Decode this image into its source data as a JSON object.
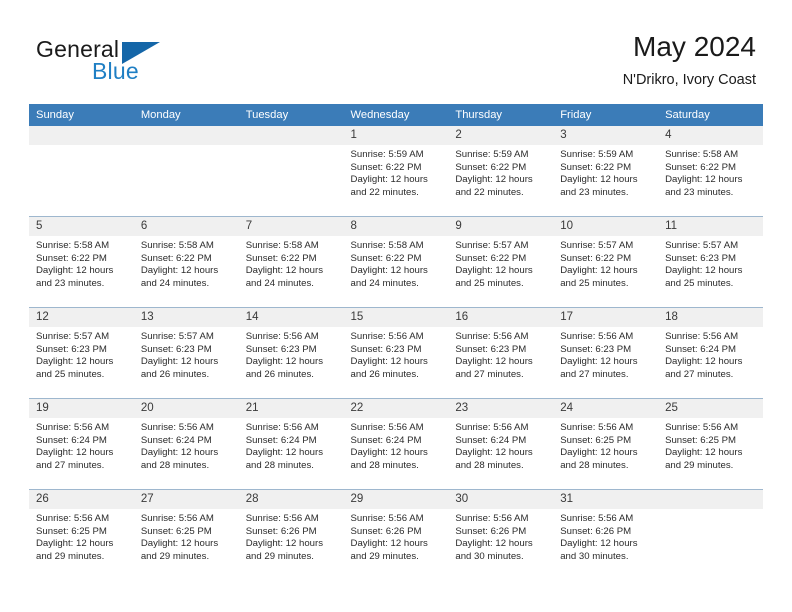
{
  "brand": {
    "word1": "General",
    "word2": "Blue",
    "flag_color": "#1466a8",
    "blue_color": "#1f7fc4"
  },
  "header": {
    "title": "May 2024",
    "subtitle": "N'Drikro, Ivory Coast"
  },
  "colors": {
    "header_row": "#3b7cb8",
    "daynum_band": "#f0f0f0",
    "grid_line": "#9fb8cf",
    "text": "#2b2b2b"
  },
  "weekday_headers": [
    "Sunday",
    "Monday",
    "Tuesday",
    "Wednesday",
    "Thursday",
    "Friday",
    "Saturday"
  ],
  "labels": {
    "sunrise_prefix": "Sunrise: ",
    "sunset_prefix": "Sunset: ",
    "daylight_prefix": "Daylight: "
  },
  "weeks": [
    [
      {
        "day": "",
        "blank": true,
        "sunrise": "",
        "sunset": "",
        "daylight_line1": "",
        "daylight_line2": ""
      },
      {
        "day": "",
        "blank": true,
        "sunrise": "",
        "sunset": "",
        "daylight_line1": "",
        "daylight_line2": ""
      },
      {
        "day": "",
        "blank": true,
        "sunrise": "",
        "sunset": "",
        "daylight_line1": "",
        "daylight_line2": ""
      },
      {
        "day": "1",
        "blank": false,
        "sunrise": "Sunrise: 5:59 AM",
        "sunset": "Sunset: 6:22 PM",
        "daylight_line1": "Daylight: 12 hours",
        "daylight_line2": "and 22 minutes."
      },
      {
        "day": "2",
        "blank": false,
        "sunrise": "Sunrise: 5:59 AM",
        "sunset": "Sunset: 6:22 PM",
        "daylight_line1": "Daylight: 12 hours",
        "daylight_line2": "and 22 minutes."
      },
      {
        "day": "3",
        "blank": false,
        "sunrise": "Sunrise: 5:59 AM",
        "sunset": "Sunset: 6:22 PM",
        "daylight_line1": "Daylight: 12 hours",
        "daylight_line2": "and 23 minutes."
      },
      {
        "day": "4",
        "blank": false,
        "sunrise": "Sunrise: 5:58 AM",
        "sunset": "Sunset: 6:22 PM",
        "daylight_line1": "Daylight: 12 hours",
        "daylight_line2": "and 23 minutes."
      }
    ],
    [
      {
        "day": "5",
        "blank": false,
        "sunrise": "Sunrise: 5:58 AM",
        "sunset": "Sunset: 6:22 PM",
        "daylight_line1": "Daylight: 12 hours",
        "daylight_line2": "and 23 minutes."
      },
      {
        "day": "6",
        "blank": false,
        "sunrise": "Sunrise: 5:58 AM",
        "sunset": "Sunset: 6:22 PM",
        "daylight_line1": "Daylight: 12 hours",
        "daylight_line2": "and 24 minutes."
      },
      {
        "day": "7",
        "blank": false,
        "sunrise": "Sunrise: 5:58 AM",
        "sunset": "Sunset: 6:22 PM",
        "daylight_line1": "Daylight: 12 hours",
        "daylight_line2": "and 24 minutes."
      },
      {
        "day": "8",
        "blank": false,
        "sunrise": "Sunrise: 5:58 AM",
        "sunset": "Sunset: 6:22 PM",
        "daylight_line1": "Daylight: 12 hours",
        "daylight_line2": "and 24 minutes."
      },
      {
        "day": "9",
        "blank": false,
        "sunrise": "Sunrise: 5:57 AM",
        "sunset": "Sunset: 6:22 PM",
        "daylight_line1": "Daylight: 12 hours",
        "daylight_line2": "and 25 minutes."
      },
      {
        "day": "10",
        "blank": false,
        "sunrise": "Sunrise: 5:57 AM",
        "sunset": "Sunset: 6:22 PM",
        "daylight_line1": "Daylight: 12 hours",
        "daylight_line2": "and 25 minutes."
      },
      {
        "day": "11",
        "blank": false,
        "sunrise": "Sunrise: 5:57 AM",
        "sunset": "Sunset: 6:23 PM",
        "daylight_line1": "Daylight: 12 hours",
        "daylight_line2": "and 25 minutes."
      }
    ],
    [
      {
        "day": "12",
        "blank": false,
        "sunrise": "Sunrise: 5:57 AM",
        "sunset": "Sunset: 6:23 PM",
        "daylight_line1": "Daylight: 12 hours",
        "daylight_line2": "and 25 minutes."
      },
      {
        "day": "13",
        "blank": false,
        "sunrise": "Sunrise: 5:57 AM",
        "sunset": "Sunset: 6:23 PM",
        "daylight_line1": "Daylight: 12 hours",
        "daylight_line2": "and 26 minutes."
      },
      {
        "day": "14",
        "blank": false,
        "sunrise": "Sunrise: 5:56 AM",
        "sunset": "Sunset: 6:23 PM",
        "daylight_line1": "Daylight: 12 hours",
        "daylight_line2": "and 26 minutes."
      },
      {
        "day": "15",
        "blank": false,
        "sunrise": "Sunrise: 5:56 AM",
        "sunset": "Sunset: 6:23 PM",
        "daylight_line1": "Daylight: 12 hours",
        "daylight_line2": "and 26 minutes."
      },
      {
        "day": "16",
        "blank": false,
        "sunrise": "Sunrise: 5:56 AM",
        "sunset": "Sunset: 6:23 PM",
        "daylight_line1": "Daylight: 12 hours",
        "daylight_line2": "and 27 minutes."
      },
      {
        "day": "17",
        "blank": false,
        "sunrise": "Sunrise: 5:56 AM",
        "sunset": "Sunset: 6:23 PM",
        "daylight_line1": "Daylight: 12 hours",
        "daylight_line2": "and 27 minutes."
      },
      {
        "day": "18",
        "blank": false,
        "sunrise": "Sunrise: 5:56 AM",
        "sunset": "Sunset: 6:24 PM",
        "daylight_line1": "Daylight: 12 hours",
        "daylight_line2": "and 27 minutes."
      }
    ],
    [
      {
        "day": "19",
        "blank": false,
        "sunrise": "Sunrise: 5:56 AM",
        "sunset": "Sunset: 6:24 PM",
        "daylight_line1": "Daylight: 12 hours",
        "daylight_line2": "and 27 minutes."
      },
      {
        "day": "20",
        "blank": false,
        "sunrise": "Sunrise: 5:56 AM",
        "sunset": "Sunset: 6:24 PM",
        "daylight_line1": "Daylight: 12 hours",
        "daylight_line2": "and 28 minutes."
      },
      {
        "day": "21",
        "blank": false,
        "sunrise": "Sunrise: 5:56 AM",
        "sunset": "Sunset: 6:24 PM",
        "daylight_line1": "Daylight: 12 hours",
        "daylight_line2": "and 28 minutes."
      },
      {
        "day": "22",
        "blank": false,
        "sunrise": "Sunrise: 5:56 AM",
        "sunset": "Sunset: 6:24 PM",
        "daylight_line1": "Daylight: 12 hours",
        "daylight_line2": "and 28 minutes."
      },
      {
        "day": "23",
        "blank": false,
        "sunrise": "Sunrise: 5:56 AM",
        "sunset": "Sunset: 6:24 PM",
        "daylight_line1": "Daylight: 12 hours",
        "daylight_line2": "and 28 minutes."
      },
      {
        "day": "24",
        "blank": false,
        "sunrise": "Sunrise: 5:56 AM",
        "sunset": "Sunset: 6:25 PM",
        "daylight_line1": "Daylight: 12 hours",
        "daylight_line2": "and 28 minutes."
      },
      {
        "day": "25",
        "blank": false,
        "sunrise": "Sunrise: 5:56 AM",
        "sunset": "Sunset: 6:25 PM",
        "daylight_line1": "Daylight: 12 hours",
        "daylight_line2": "and 29 minutes."
      }
    ],
    [
      {
        "day": "26",
        "blank": false,
        "sunrise": "Sunrise: 5:56 AM",
        "sunset": "Sunset: 6:25 PM",
        "daylight_line1": "Daylight: 12 hours",
        "daylight_line2": "and 29 minutes."
      },
      {
        "day": "27",
        "blank": false,
        "sunrise": "Sunrise: 5:56 AM",
        "sunset": "Sunset: 6:25 PM",
        "daylight_line1": "Daylight: 12 hours",
        "daylight_line2": "and 29 minutes."
      },
      {
        "day": "28",
        "blank": false,
        "sunrise": "Sunrise: 5:56 AM",
        "sunset": "Sunset: 6:26 PM",
        "daylight_line1": "Daylight: 12 hours",
        "daylight_line2": "and 29 minutes."
      },
      {
        "day": "29",
        "blank": false,
        "sunrise": "Sunrise: 5:56 AM",
        "sunset": "Sunset: 6:26 PM",
        "daylight_line1": "Daylight: 12 hours",
        "daylight_line2": "and 29 minutes."
      },
      {
        "day": "30",
        "blank": false,
        "sunrise": "Sunrise: 5:56 AM",
        "sunset": "Sunset: 6:26 PM",
        "daylight_line1": "Daylight: 12 hours",
        "daylight_line2": "and 30 minutes."
      },
      {
        "day": "31",
        "blank": false,
        "sunrise": "Sunrise: 5:56 AM",
        "sunset": "Sunset: 6:26 PM",
        "daylight_line1": "Daylight: 12 hours",
        "daylight_line2": "and 30 minutes."
      },
      {
        "day": "",
        "blank": true,
        "sunrise": "",
        "sunset": "",
        "daylight_line1": "",
        "daylight_line2": ""
      }
    ]
  ]
}
